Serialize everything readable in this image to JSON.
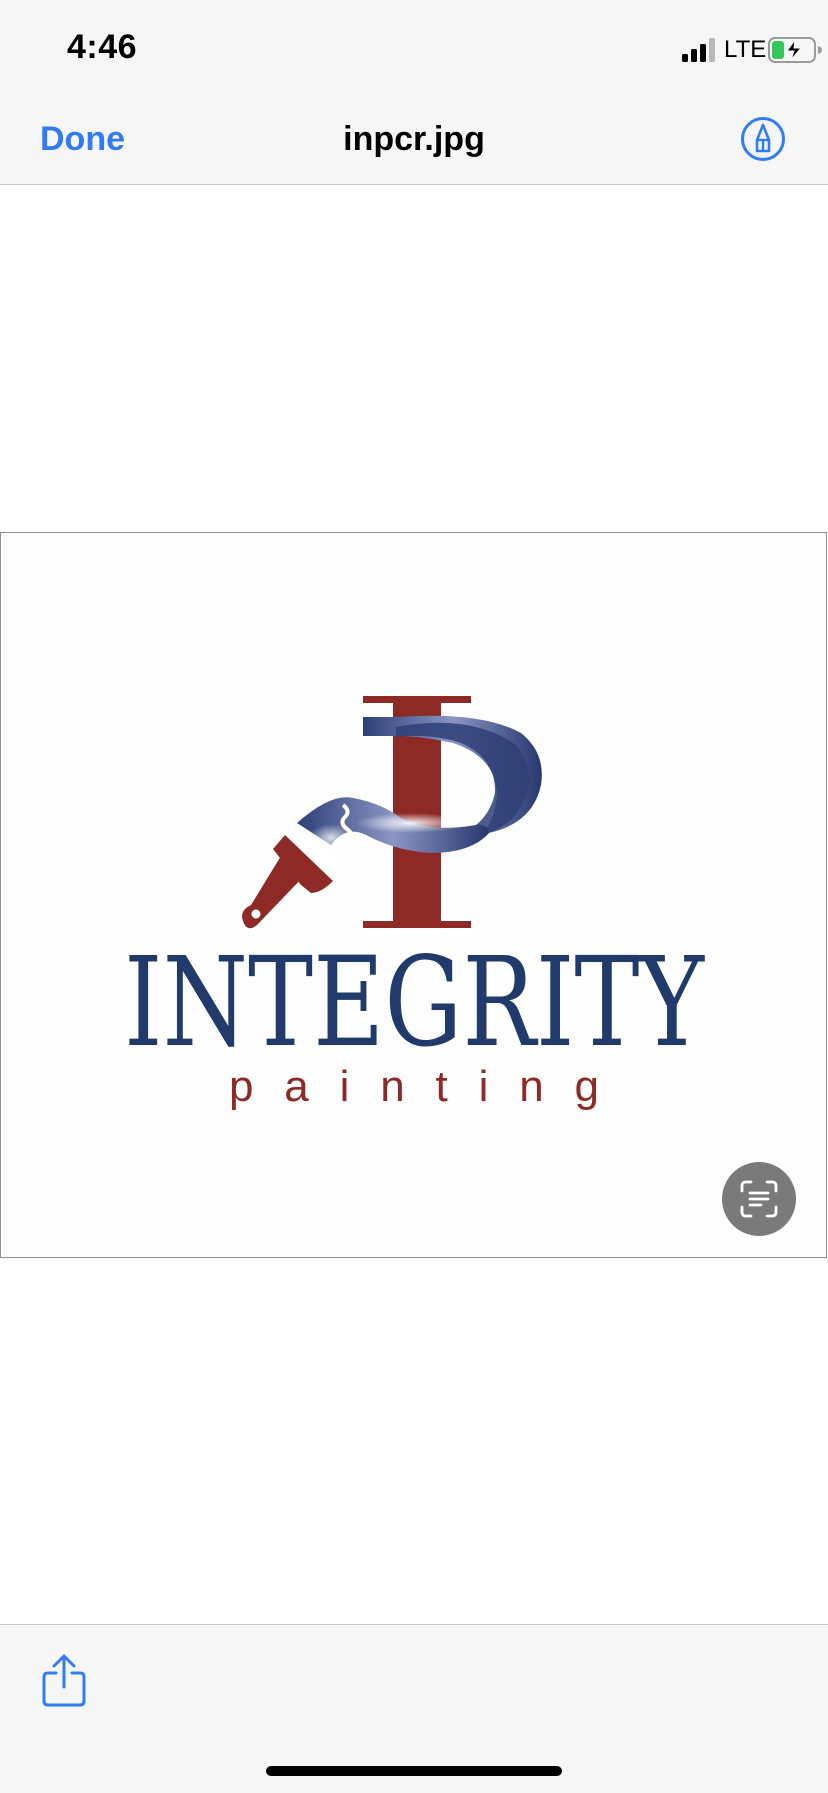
{
  "status_bar": {
    "time": "4:46",
    "network": "LTE",
    "icons": [
      "cellular-signal-icon",
      "battery-charging-icon"
    ]
  },
  "nav": {
    "done_label": "Done",
    "title": "inpcr.jpg",
    "markup_icon": "markup-pen-icon"
  },
  "image": {
    "logo_wordmark": "INTEGRITY",
    "logo_tagline": "painting",
    "colors": {
      "navy": "#1f3a6b",
      "red": "#8e2a26"
    }
  },
  "overlay": {
    "live_text_icon": "live-text-icon"
  },
  "toolbar": {
    "share_icon": "share-icon"
  },
  "colors": {
    "accent": "#2f7cf6",
    "bars": "#f6f6f6"
  }
}
